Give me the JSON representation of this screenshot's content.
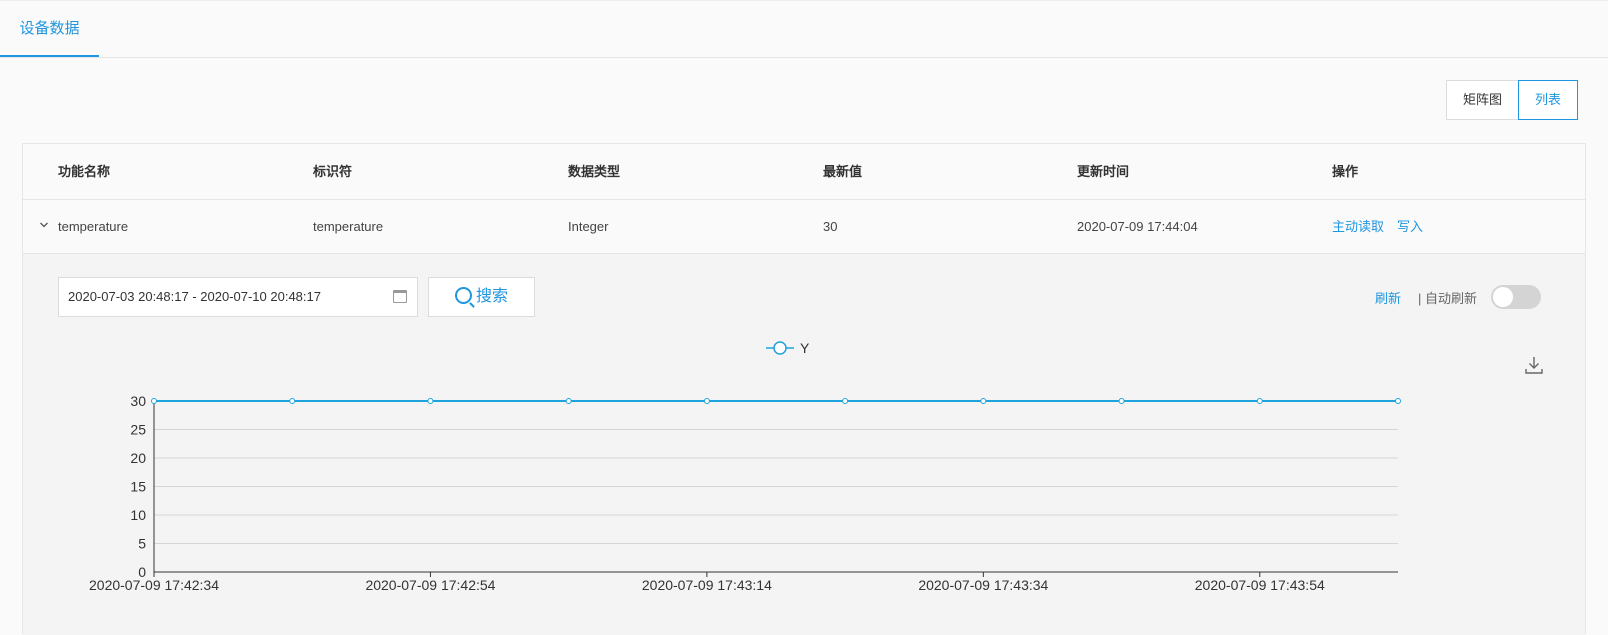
{
  "tabs": [
    {
      "label": "设备数据"
    }
  ],
  "view_toggle": {
    "matrix": "矩阵图",
    "list": "列表"
  },
  "table": {
    "headers": [
      "功能名称",
      "标识符",
      "数据类型",
      "最新值",
      "更新时间",
      "操作"
    ],
    "rows": [
      {
        "name": "temperature",
        "identifier": "temperature",
        "type": "Integer",
        "latest": "30",
        "updated": "2020-07-09 17:44:04",
        "actions": [
          "主动读取",
          "写入"
        ]
      }
    ]
  },
  "filter": {
    "date_range": "2020-07-03 20:48:17 - 2020-07-10 20:48:17",
    "search_label": "搜索",
    "refresh_label": "刷新",
    "auto_refresh_label": "| 自动刷新",
    "auto_refresh_on": false
  },
  "colors": {
    "accent": "#1e96e0",
    "series": "#1ea3dc"
  },
  "icons": {
    "search": "search-icon",
    "calendar": "calendar-icon",
    "download": "download-icon",
    "expand": "chevron-down-icon"
  },
  "chart_data": {
    "type": "line",
    "title": "",
    "legend": {
      "entries": [
        "Y"
      ],
      "placement": "top-center"
    },
    "xlabel": "",
    "ylabel": "",
    "ylim": [
      0,
      30
    ],
    "yticks": [
      0,
      5,
      10,
      15,
      20,
      25,
      30
    ],
    "x_tick_labels": [
      "2020-07-09 17:42:34",
      "2020-07-09 17:42:54",
      "2020-07-09 17:43:14",
      "2020-07-09 17:43:34",
      "2020-07-09 17:43:54"
    ],
    "series": [
      {
        "name": "Y",
        "x": [
          "2020-07-09 17:42:34",
          "2020-07-09 17:42:44",
          "2020-07-09 17:42:54",
          "2020-07-09 17:43:04",
          "2020-07-09 17:43:14",
          "2020-07-09 17:43:24",
          "2020-07-09 17:43:34",
          "2020-07-09 17:43:44",
          "2020-07-09 17:43:54",
          "2020-07-09 17:44:04"
        ],
        "values": [
          30,
          30,
          30,
          30,
          30,
          30,
          30,
          30,
          30,
          30
        ]
      }
    ],
    "grid": true
  }
}
